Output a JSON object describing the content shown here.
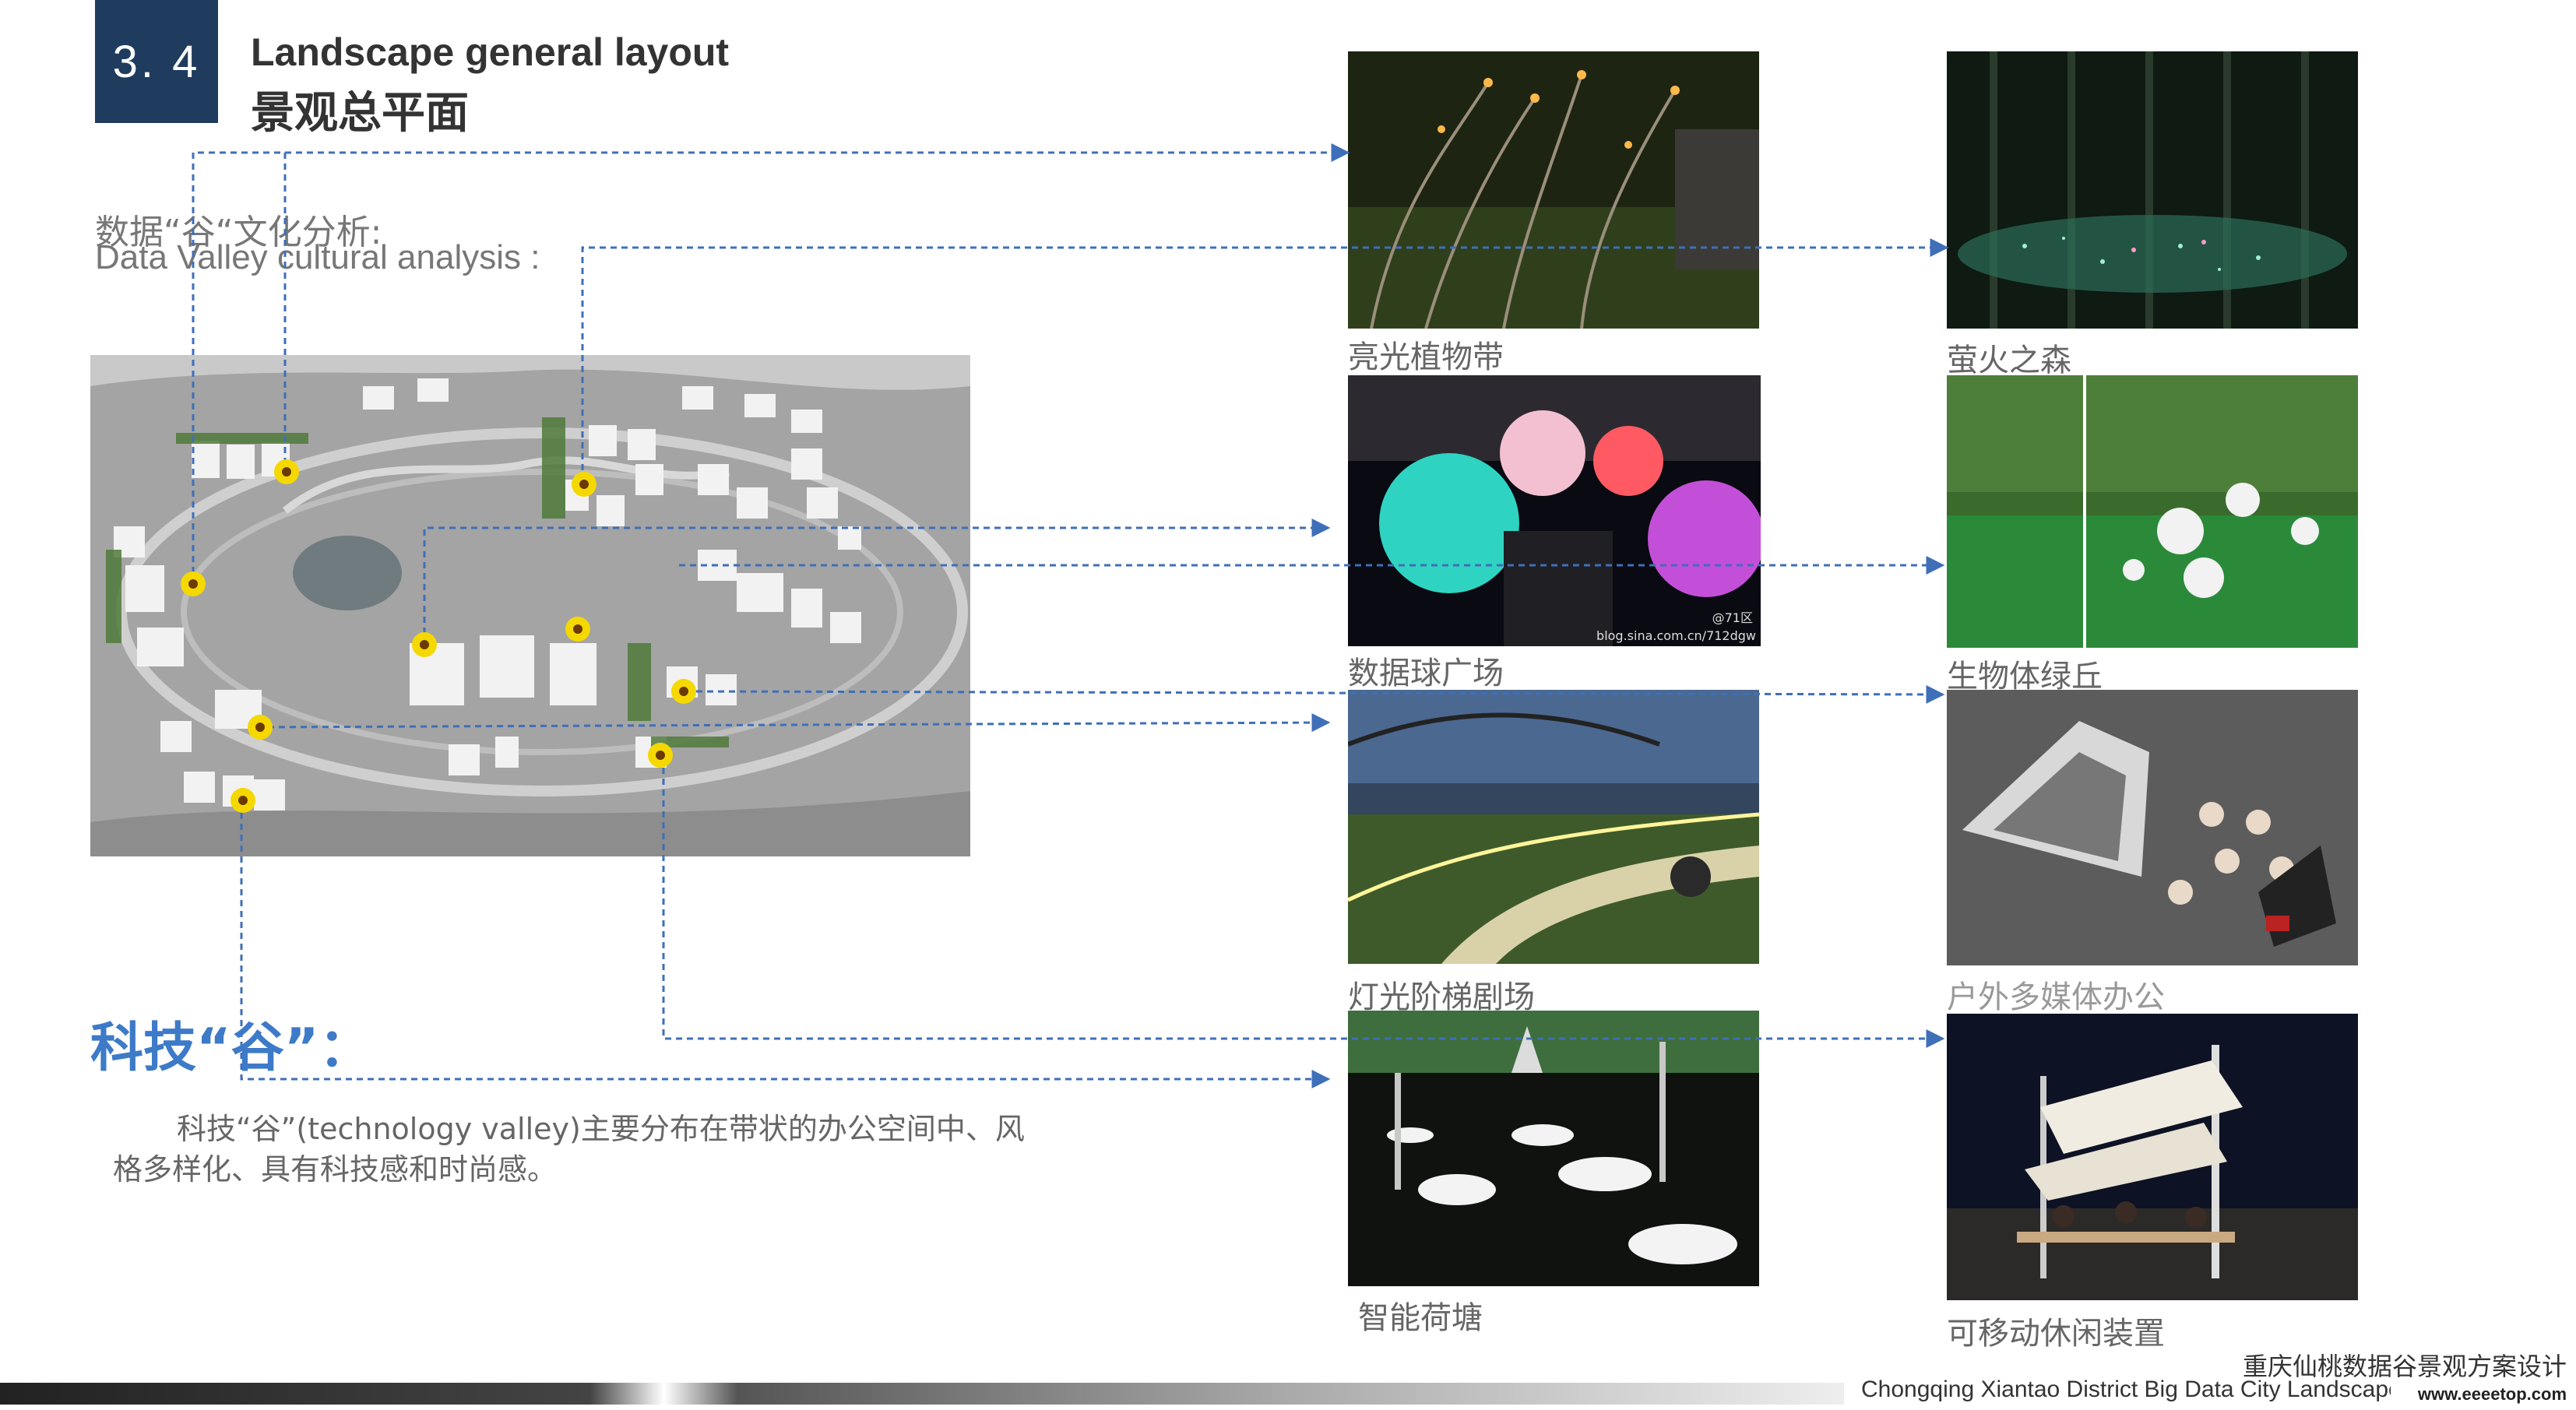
{
  "header": {
    "section_number": "3. 4",
    "title_en": "Landscape general layout",
    "title_cn": "景观总平面"
  },
  "analysis": {
    "label_cn": "数据“谷“文化分析:",
    "label_en": "Data Valley cultural analysis :"
  },
  "tech_valley": {
    "heading": "科技“谷”：",
    "description": "科技“谷”(technology valley)主要分布在带状的办公空间中、风格多样化、具有科技感和时尚感。"
  },
  "photos": [
    {
      "caption": "亮光植物带"
    },
    {
      "caption": "萤火之森"
    },
    {
      "caption": "数据球广场",
      "overlay": "blog.sina.com.cn/712dgw",
      "badge": "@71区"
    },
    {
      "caption": "生物体绿丘"
    },
    {
      "caption": "灯光阶梯剧场"
    },
    {
      "caption": "户外多媒体办公"
    },
    {
      "caption": "智能荷塘"
    },
    {
      "caption": "可移动休闲装置"
    }
  ],
  "footer": {
    "title_cn": "重庆仙桃数据谷景观方案设计",
    "title_en": "Chongqing Xiantao District Big Data City Landscape Concept Design",
    "watermark": "www.eeeetop.com"
  },
  "colors": {
    "badge": "#1f3c5f",
    "accent_blue": "#3d7ac8",
    "connector": "#3f6fb8",
    "marker_yellow": "#f5d800"
  }
}
